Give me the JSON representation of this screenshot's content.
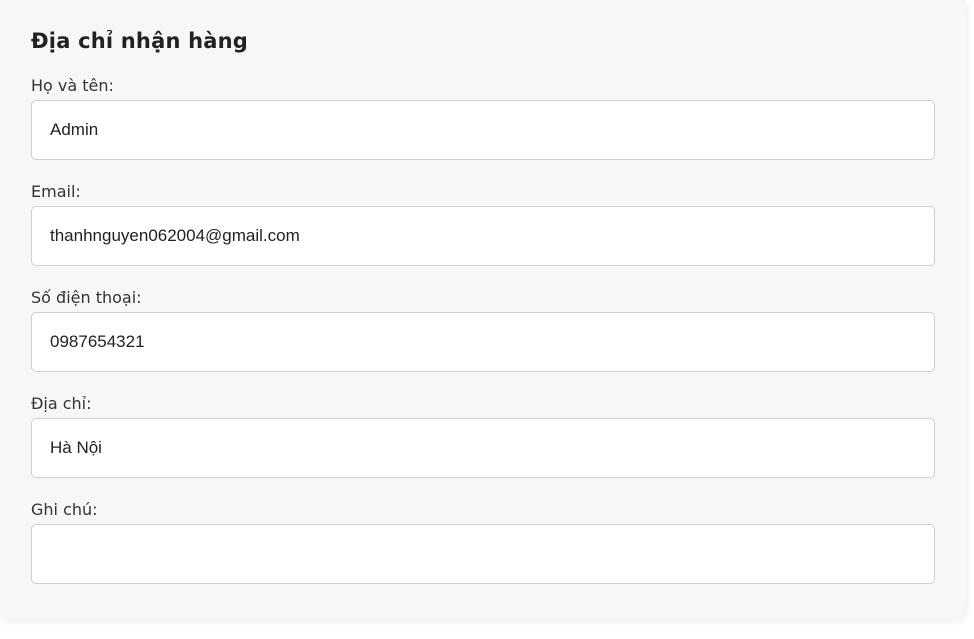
{
  "form": {
    "title": "Địa chỉ nhận hàng",
    "fields": [
      {
        "label": "Họ và tên:",
        "value": "Admin",
        "placeholder": ""
      },
      {
        "label": "Email:",
        "value": "thanhnguyen062004@gmail.com",
        "placeholder": ""
      },
      {
        "label": "Số điện thoại:",
        "value": "0987654321",
        "placeholder": ""
      },
      {
        "label": "Địa chỉ:",
        "value": "Hà Nội",
        "placeholder": ""
      },
      {
        "label": "Ghi chú:",
        "value": "",
        "placeholder": ""
      }
    ]
  }
}
